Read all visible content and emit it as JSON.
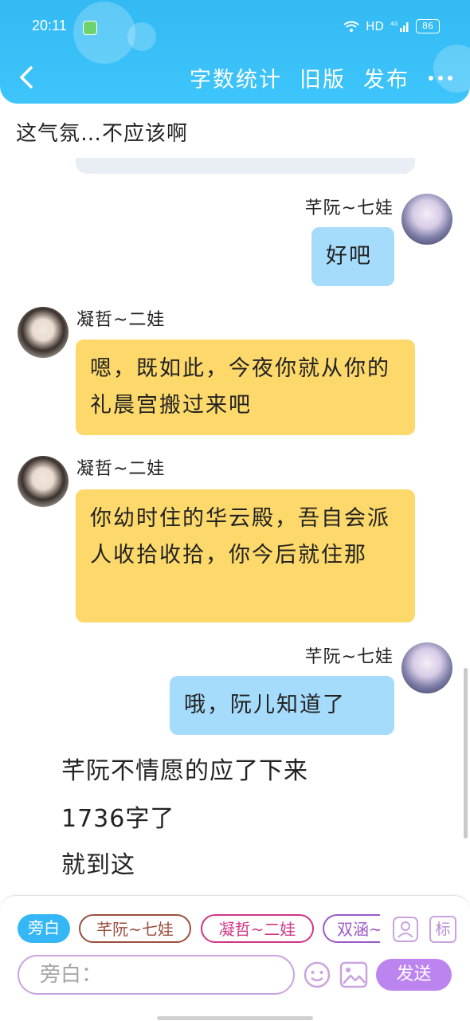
{
  "status": {
    "time": "20:11",
    "network": "HD",
    "signal": "4G",
    "battery": "86"
  },
  "header": {
    "word_count": "字数统计",
    "old_version": "旧版",
    "publish": "发布"
  },
  "chat": {
    "top_narration": "这气氛…不应该啊",
    "messages": [
      {
        "sender": "芊阮~七娃",
        "text": "好吧"
      },
      {
        "sender": "凝哲~二娃",
        "text": "嗯，既如此，今夜你就从你的礼晨宫搬过来吧"
      },
      {
        "sender": "凝哲~二娃",
        "text": "你幼时住的华云殿，吾自会派人收拾收拾，你今后就住那"
      },
      {
        "sender": "芊阮~七娃",
        "text": "哦，阮儿知道了"
      }
    ],
    "narrations": [
      "芊阮不情愿的应了下来",
      "1736字了",
      "就到这"
    ]
  },
  "composer": {
    "chips": [
      "旁白",
      "芊阮~七娃",
      "凝哲~二娃",
      "双涵~"
    ],
    "avatar_label": "",
    "tag_label": "标",
    "input_placeholder": "旁白：",
    "send_label": "发送"
  },
  "colors": {
    "header": "#3ec5fb",
    "blue_bubble": "#a6dcfb",
    "yellow_bubble": "#fdd86a",
    "send": "#bc84ef"
  }
}
